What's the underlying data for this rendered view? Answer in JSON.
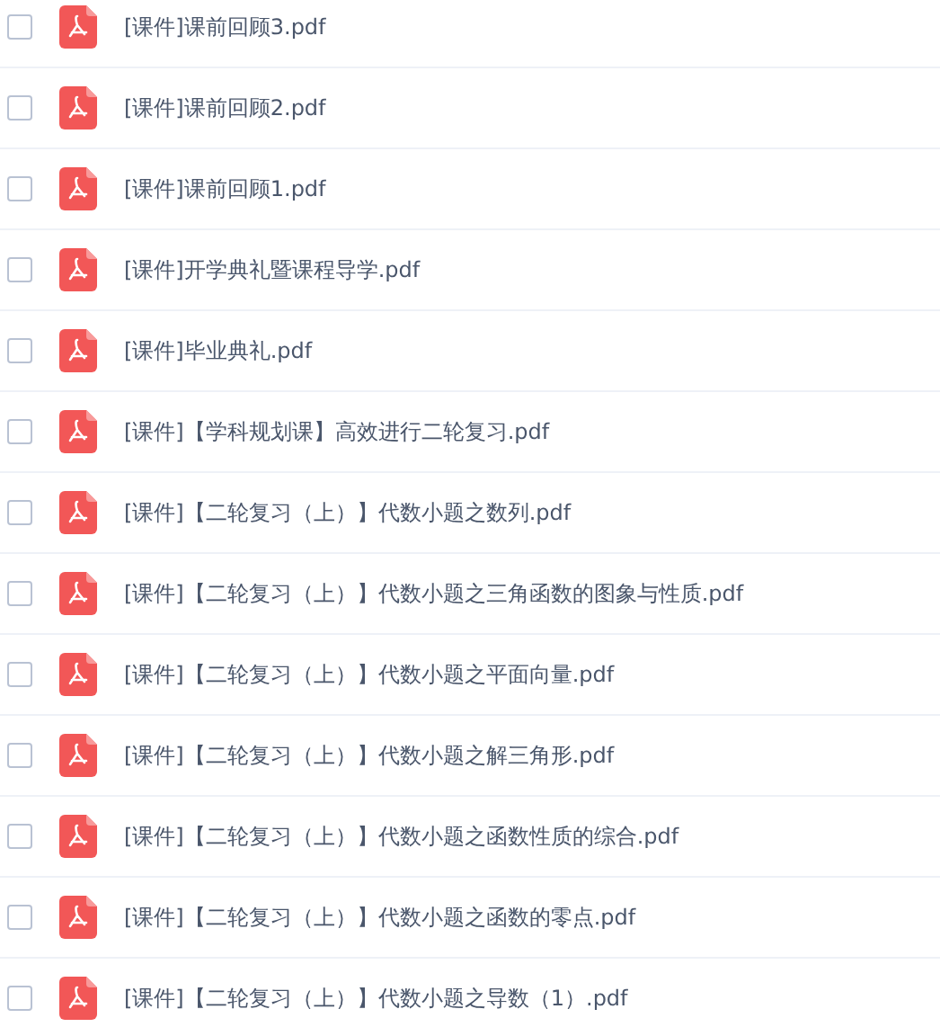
{
  "files": [
    {
      "name": "[课件]课前回顾3.pdf",
      "checked": false
    },
    {
      "name": "[课件]课前回顾2.pdf",
      "checked": false
    },
    {
      "name": "[课件]课前回顾1.pdf",
      "checked": false
    },
    {
      "name": "[课件]开学典礼暨课程导学.pdf",
      "checked": false
    },
    {
      "name": "[课件]毕业典礼.pdf",
      "checked": false
    },
    {
      "name": "[课件]【学科规划课】高效进行二轮复习.pdf",
      "checked": false
    },
    {
      "name": "[课件]【二轮复习（上）】代数小题之数列.pdf",
      "checked": false
    },
    {
      "name": "[课件]【二轮复习（上）】代数小题之三角函数的图象与性质.pdf",
      "checked": false
    },
    {
      "name": "[课件]【二轮复习（上）】代数小题之平面向量.pdf",
      "checked": false
    },
    {
      "name": "[课件]【二轮复习（上）】代数小题之解三角形.pdf",
      "checked": false
    },
    {
      "name": "[课件]【二轮复习（上）】代数小题之函数性质的综合.pdf",
      "checked": false
    },
    {
      "name": "[课件]【二轮复习（上）】代数小题之函数的零点.pdf",
      "checked": false
    },
    {
      "name": "[课件]【二轮复习（上）】代数小题之导数（1）.pdf",
      "checked": false
    }
  ]
}
